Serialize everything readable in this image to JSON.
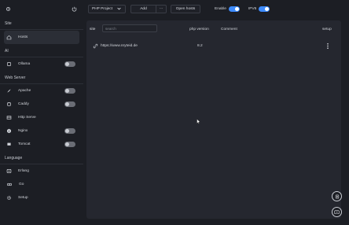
{
  "sidebar": {
    "sections": [
      {
        "title": "Site"
      },
      {
        "title": "AI"
      },
      {
        "title": "Web Server"
      },
      {
        "title": "Language"
      }
    ],
    "items": {
      "hosts": "Hosts",
      "ollama": "Ollama",
      "apache": "Apache",
      "caddy": "Caddy",
      "http_serve": "Http Serve",
      "nginx": "Nginx",
      "tomcat": "Tomcat",
      "erlang": "Erlang",
      "go": "Go",
      "setup": "Setup"
    },
    "toggles": {
      "ollama": false,
      "apache": false,
      "caddy": false,
      "nginx": false,
      "tomcat": false
    }
  },
  "toolbar": {
    "project_select": "PHP Project",
    "add_label": "Add",
    "more_label": "···",
    "open_hosts_label": "Open hosts",
    "enable_label": "Enable",
    "enable_on": true,
    "ipv6_label": "IPV6",
    "ipv6_on": true
  },
  "table": {
    "columns": [
      "site",
      "php version",
      "Comment",
      "setup"
    ],
    "search_placeholder": "search",
    "rows": [
      {
        "site": "https://www.nryteid.de",
        "php_version": "8.2",
        "comment": ""
      }
    ]
  },
  "colors": {
    "accent": "#3d8bff",
    "background": "#1c1e24",
    "panel": "#25272f"
  }
}
